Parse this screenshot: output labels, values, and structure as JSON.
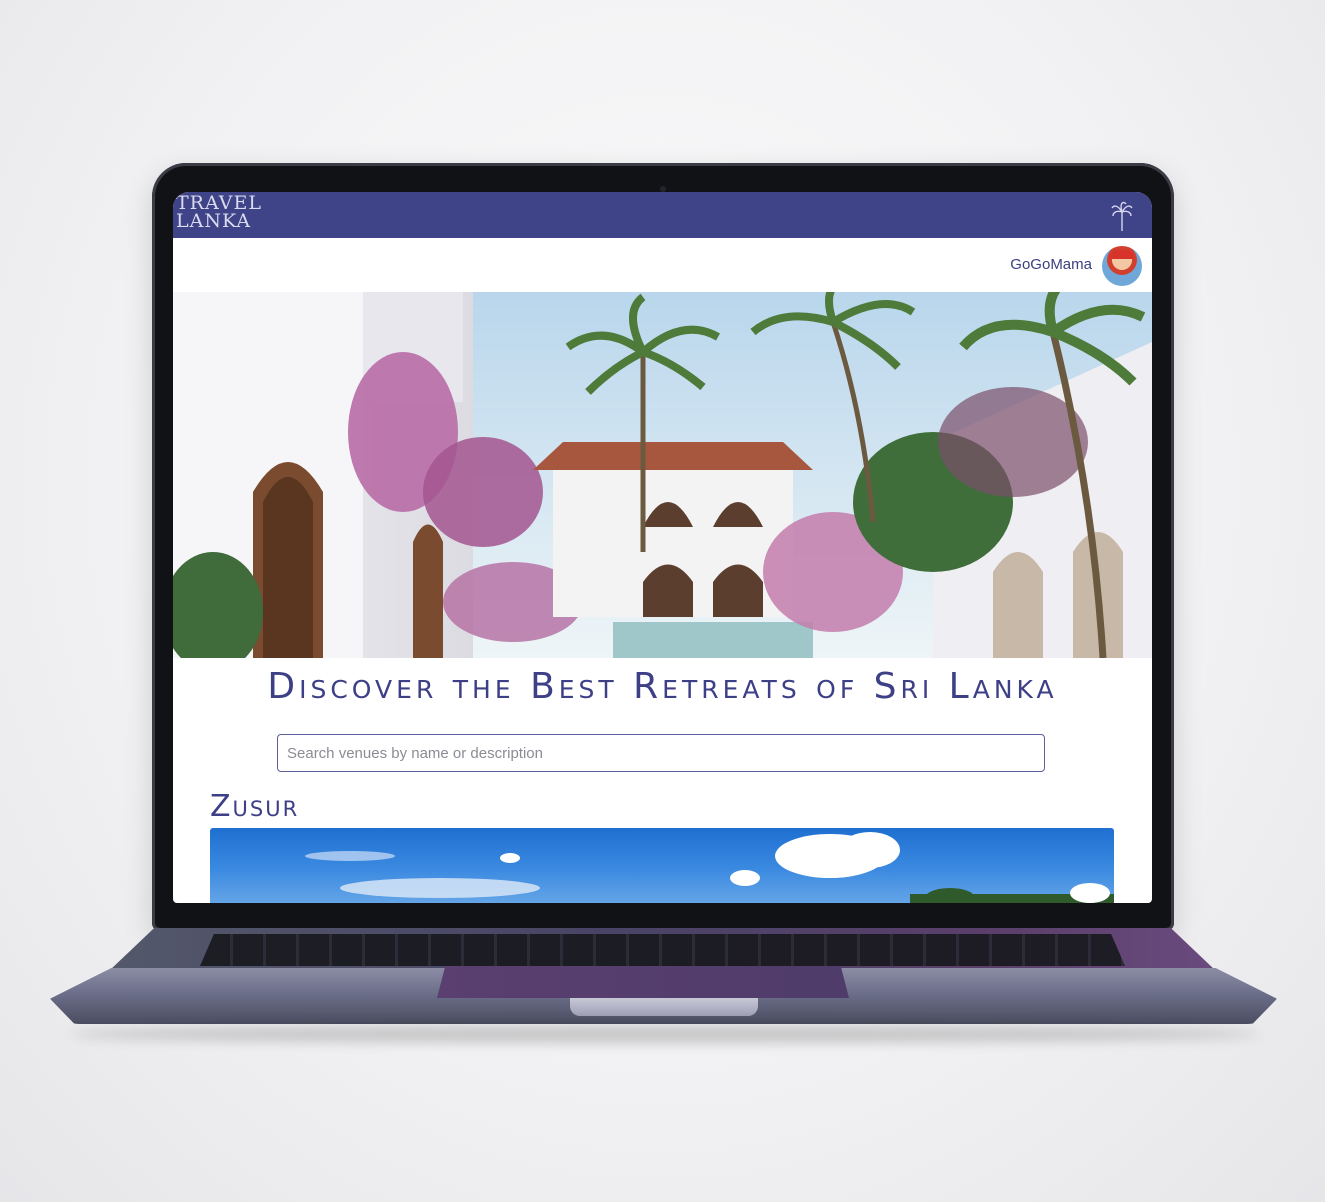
{
  "app": {
    "logo_line1": "TRAVEL",
    "logo_line2": "LANKA",
    "brand_color": "#3f4388"
  },
  "header": {
    "icon": "palm-tree-icon",
    "username": "GoGoMama",
    "avatar": "avatar"
  },
  "main": {
    "headline": "Discover the Best Retreats of Sri Lanka",
    "search": {
      "placeholder": "Search venues by name or description",
      "value": ""
    },
    "venues": [
      {
        "name": "Zusur"
      }
    ]
  },
  "colors": {
    "accent": "#3d3f87",
    "topbar": "#3f4388",
    "background": "#ffffff"
  }
}
